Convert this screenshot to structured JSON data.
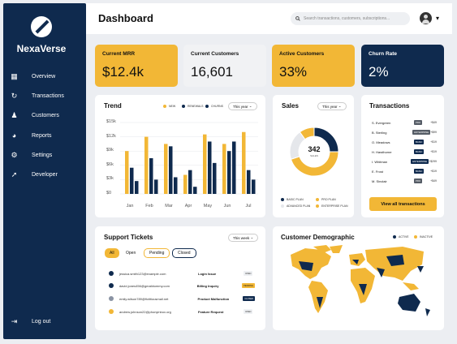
{
  "app": {
    "brand": "NexaVerse"
  },
  "nav": {
    "items": [
      {
        "label": "Overview",
        "icon": "grid-icon"
      },
      {
        "label": "Transactions",
        "icon": "cycle-icon"
      },
      {
        "label": "Customers",
        "icon": "people-icon"
      },
      {
        "label": "Reports",
        "icon": "pie-icon"
      },
      {
        "label": "Settings",
        "icon": "gear-icon"
      },
      {
        "label": "Developer",
        "icon": "rocket-icon"
      }
    ],
    "logout": "Log out"
  },
  "header": {
    "title": "Dashboard",
    "search_placeholder": "Search transactions, customers, subscriptions..."
  },
  "kpis": [
    {
      "label": "Current MRR",
      "value": "$12.4k",
      "bg": "#f2b736"
    },
    {
      "label": "Current Customers",
      "value": "16,601",
      "bg": "#f1f2f4"
    },
    {
      "label": "Active Customers",
      "value": "33%",
      "bg": "#f2b736"
    },
    {
      "label": "Churn Rate",
      "value": "2%",
      "bg": "#0f2a4e"
    }
  ],
  "trend": {
    "title": "Trend",
    "range": "This year",
    "legend": [
      "NEW",
      "RENEWALS",
      "CHURNS"
    ]
  },
  "chart_data": {
    "type": "bar",
    "categories": [
      "Jan",
      "Feb",
      "Mar",
      "Apr",
      "May",
      "Jun",
      "Jul"
    ],
    "series": [
      {
        "name": "NEW",
        "color": "#f2b736",
        "values": [
          9.0,
          12.0,
          10.5,
          4.0,
          12.5,
          10.5,
          13.0
        ]
      },
      {
        "name": "RENEWALS",
        "color": "#0f2a4e",
        "values": [
          5.5,
          7.5,
          10.0,
          5.0,
          11.0,
          9.0,
          5.0
        ]
      },
      {
        "name": "CHURNS",
        "color": "#0f2a4e",
        "values": [
          2.7,
          3.0,
          3.5,
          1.5,
          6.5,
          11.0,
          3.0
        ]
      }
    ],
    "ylim": [
      0,
      15
    ],
    "yticks": [
      "$0",
      "$3k",
      "$6k",
      "$9k",
      "$12k",
      "$15k"
    ],
    "grid": true,
    "legend_position": "top-right"
  },
  "sales": {
    "title": "Sales",
    "range": "This year",
    "center_value": "342",
    "center_label": "SALES",
    "segments": [
      {
        "name": "BASIC PLAN",
        "value": 25,
        "color": "#0f2a4e"
      },
      {
        "name": "PRO PLAN",
        "value": 45,
        "color": "#f2b736"
      },
      {
        "name": "ADVANCED PLAN",
        "value": 20,
        "color": "#e5e7eb"
      },
      {
        "name": "ENTERPRISE PLAN",
        "value": 10,
        "color": "#f2b736"
      }
    ]
  },
  "transactions": {
    "title": "Transactions",
    "button": "View all transactions",
    "rows": [
      {
        "name": "S. Evergreen",
        "badge": "PRO",
        "amount": "+$49",
        "badge_bg": "#555c66"
      },
      {
        "name": "B. Sterling",
        "badge": "ENTERPRISE",
        "amount": "+$99",
        "badge_bg": "#555c66"
      },
      {
        "name": "O. Meadows",
        "badge": "BASIC",
        "amount": "+$19",
        "badge_bg": "#0f2a4e"
      },
      {
        "name": "H. Hawthorne",
        "badge": "BASIC",
        "amount": "+$19",
        "badge_bg": "#0f2a4e"
      },
      {
        "name": "I. Whitman",
        "badge": "ENTERPRISE",
        "amount": "+$299",
        "badge_bg": "#0f2a4e"
      },
      {
        "name": "E. Frost",
        "badge": "BASIC",
        "amount": "+$19",
        "badge_bg": "#0f2a4e"
      },
      {
        "name": "M. Sinclair",
        "badge": "PRO",
        "amount": "+$49",
        "badge_bg": "#555c66"
      }
    ]
  },
  "tickets": {
    "title": "Support Tickets",
    "range": "This week",
    "filters": [
      "All",
      "Open",
      "Pending",
      "Closed"
    ],
    "rows": [
      {
        "email": "jessica.smith123@example.com",
        "subject": "Login Issue",
        "status": "OPEN",
        "dot": "#0f2a4e",
        "tag_bg": "#eef0f3",
        "tag_fg": "#333"
      },
      {
        "email": "david.jones456@gmaildummy.com",
        "subject": "Billing Inquiry",
        "status": "PENDING",
        "dot": "#0f2a4e",
        "tag_bg": "#f2b736",
        "tag_fg": "#111"
      },
      {
        "email": "emily.wilson789@fictitiousmail.net",
        "subject": "Product Malfunction",
        "status": "CLOSED",
        "dot": "#8a93a3",
        "tag_bg": "#0f2a4e",
        "tag_fg": "#fff"
      },
      {
        "email": "andrew.johnson22@phonyinbox.org",
        "subject": "Feature Request",
        "status": "OPEN",
        "dot": "#f2b736",
        "tag_bg": "#eef0f3",
        "tag_fg": "#333"
      }
    ]
  },
  "demographic": {
    "title": "Customer Demographic",
    "legend": [
      "ACTIVE",
      "INACTIVE"
    ],
    "colors": {
      "active": "#0f2a4e",
      "inactive": "#f2b736"
    }
  }
}
